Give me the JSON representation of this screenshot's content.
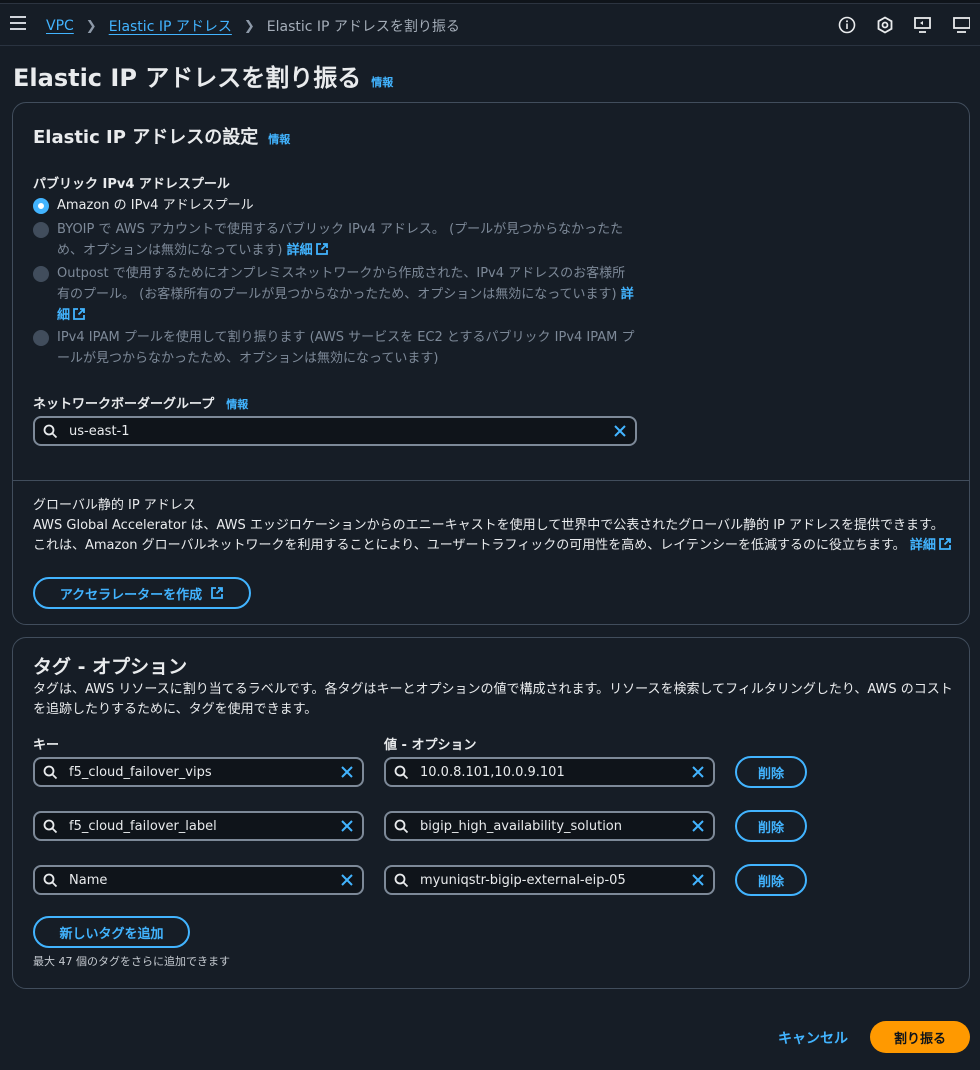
{
  "breadcrumb": {
    "items": [
      "VPC",
      "Elastic IP アドレス"
    ],
    "current": "Elastic IP アドレスを割り振る"
  },
  "top_icons": [
    "info-circle-icon",
    "hexagon-settings-icon",
    "screen-share-icon",
    "monitor-icon"
  ],
  "page": {
    "title": "Elastic IP アドレスを割り振る",
    "info": "情報"
  },
  "settings": {
    "title": "Elastic IP アドレスの設定",
    "info": "情報",
    "pool_label": "パブリック IPv4 アドレスプール",
    "options": [
      {
        "text": "Amazon の IPv4 アドレスプール",
        "selected": true,
        "disabled": false,
        "link": ""
      },
      {
        "text": "BYOIP で AWS アカウントで使用するパブリック IPv4 アドレス。 (プールが見つからなかったため、オプションは無効になっています)",
        "selected": false,
        "disabled": true,
        "link": "詳細"
      },
      {
        "text": "Outpost で使用するためにオンプレミスネットワークから作成された、IPv4 アドレスのお客様所有のプール。 (お客様所有のプールが見つからなかったため、オプションは無効になっています)",
        "selected": false,
        "disabled": true,
        "link": "詳細"
      },
      {
        "text": "IPv4 IPAM プールを使用して割り振ります (AWS サービスを EC2 とするパブリック IPv4 IPAM プールが見つからなかったため、オプションは無効になっています)",
        "selected": false,
        "disabled": true,
        "link": ""
      }
    ],
    "nbg_label": "ネットワークボーダーグループ",
    "nbg_info": "情報",
    "nbg_value": "us-east-1",
    "global_title": "グローバル静的 IP アドレス",
    "global_desc": "AWS Global Accelerator は、AWS エッジロケーションからのエニーキャストを使用して世界中で公表されたグローバル静的 IP アドレスを提供できます。これは、Amazon グローバルネットワークを利用することにより、ユーザートラフィックの可用性を高め、レイテンシーを低減するのに役立ちます。",
    "global_link": "詳細",
    "accelerator_button": "アクセラレーターを作成"
  },
  "tags": {
    "title": "タグ - オプション",
    "desc": "タグは、AWS リソースに割り当てるラベルです。各タグはキーとオプションの値で構成されます。リソースを検索してフィルタリングしたり、AWS のコストを追跡したりするために、タグを使用できます。",
    "key_header": "キー",
    "value_header": "値 - オプション",
    "rows": [
      {
        "key": "f5_cloud_failover_vips",
        "value": "10.0.8.101,10.0.9.101",
        "remove": "削除"
      },
      {
        "key": "f5_cloud_failover_label",
        "value": "bigip_high_availability_solution",
        "remove": "削除"
      },
      {
        "key": "Name",
        "value": "myuniqstr-bigip-external-eip-05",
        "remove": "削除"
      }
    ],
    "add_button": "新しいタグを追加",
    "limit_note": "最大 47 個のタグをさらに追加できます"
  },
  "footer": {
    "cancel": "キャンセル",
    "submit": "割り振る"
  },
  "colors": {
    "background": "#161d26",
    "link": "#42b4ff",
    "primary": "#ff9900",
    "border": "#414d5c"
  }
}
